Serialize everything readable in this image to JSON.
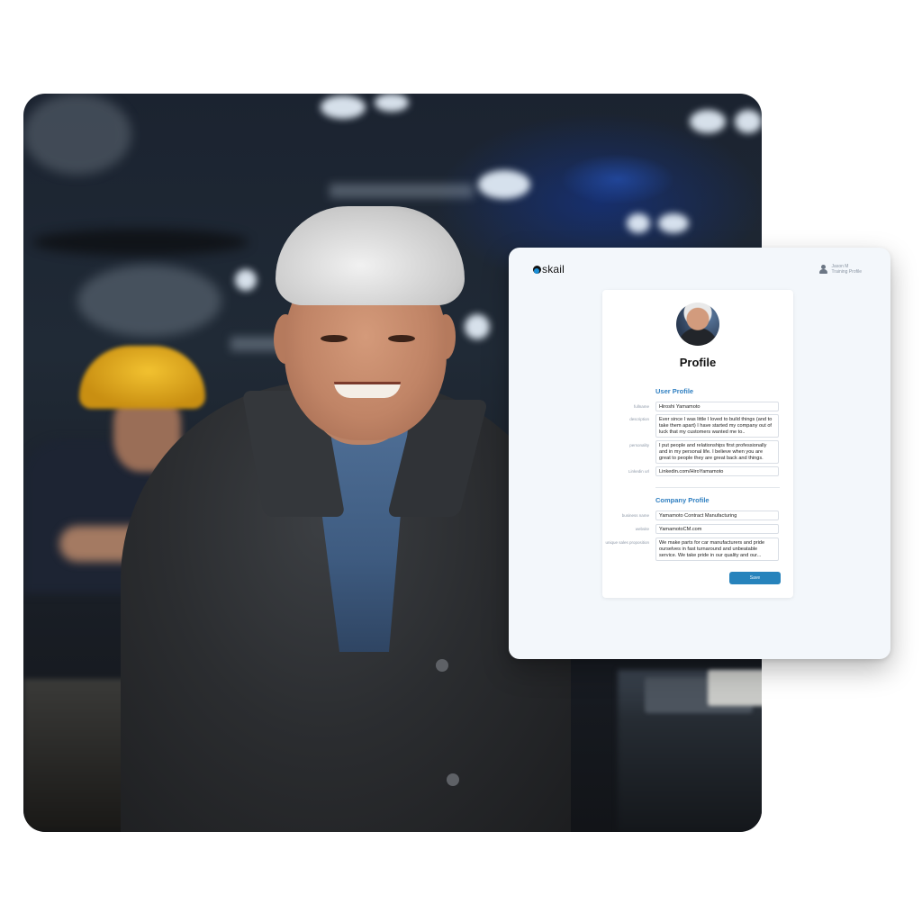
{
  "app": {
    "brand": "skail",
    "user": {
      "name": "Jason M",
      "role": "Training Profile"
    },
    "panel_title": "Profile",
    "user_profile": {
      "section_title": "User Profile",
      "fields": [
        {
          "label": "fullname",
          "value": "Hiroshi Yamamoto"
        },
        {
          "label": "description",
          "value": "Ever since I was little I loved to build things (and to take them apart) I have started my company out of luck that my customers wanted me to.."
        },
        {
          "label": "personality",
          "value": "I put people and relationships first professionally and in my personal life. I believe when you are great to people they are great back and things."
        },
        {
          "label": "Linkedin url",
          "value": "Linkedin.com/HiroYamamoto"
        }
      ]
    },
    "company_profile": {
      "section_title": "Company Profile",
      "fields": [
        {
          "label": "business name",
          "value": "Yamamoto Contract Manufacturing"
        },
        {
          "label": "website",
          "value": "YamamotoCM.com"
        },
        {
          "label": "unique sales proposition",
          "value": "We make parts for car manufacturers and pride ourselves in fast turnaround and unbeatable service. We take pride in our quality and our..."
        }
      ]
    },
    "save_label": "Save",
    "colors": {
      "accent": "#2f7fc1",
      "button": "#2783bc",
      "window_bg": "#f3f7fb"
    }
  },
  "photo": {
    "subject": "Smiling older man in dark jacket in a factory, worker in yellow hard hat behind"
  }
}
